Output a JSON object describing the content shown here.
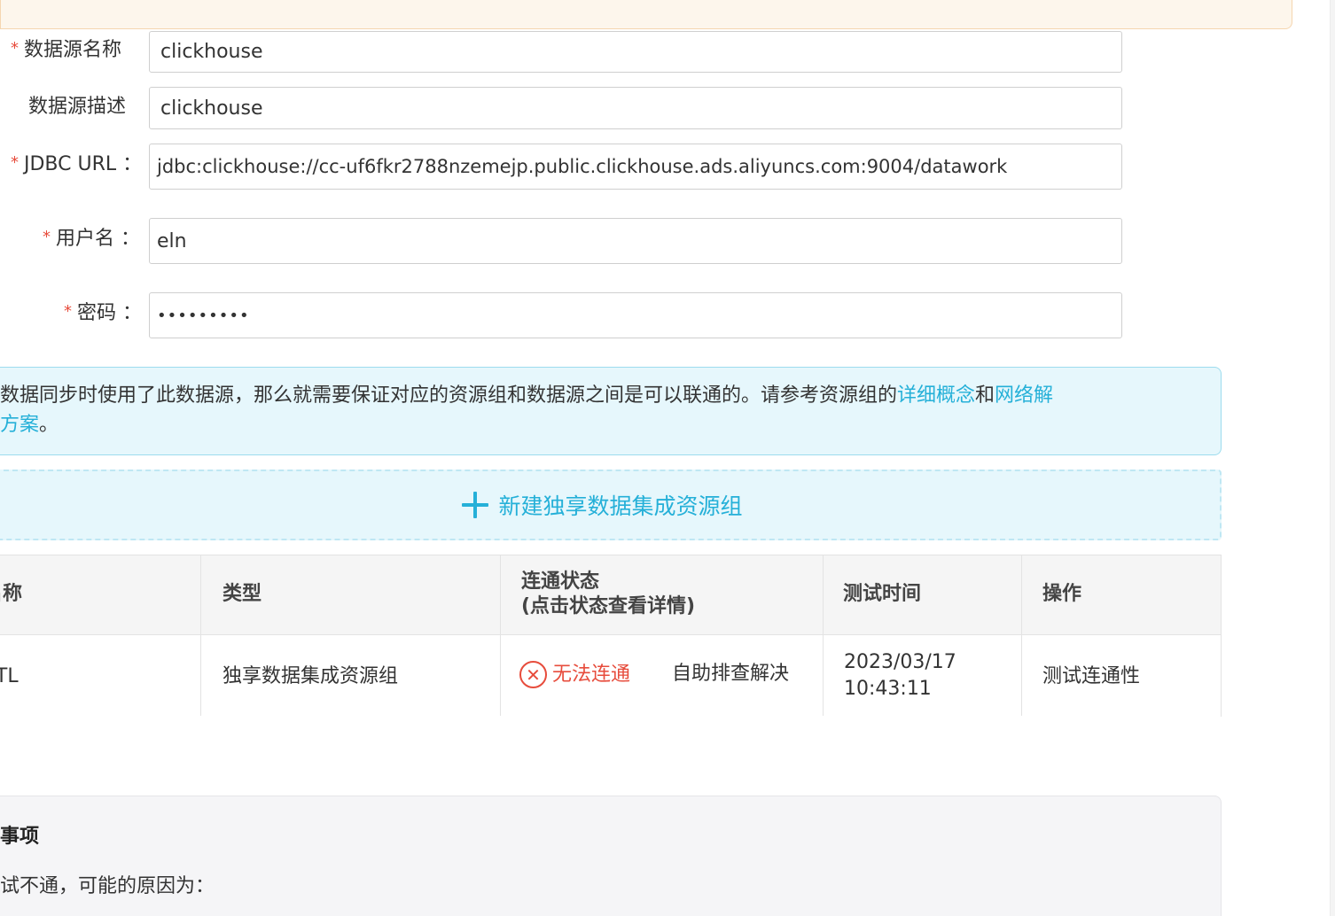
{
  "form": {
    "datasource_name": {
      "label": "数据源名称",
      "value": "clickhouse"
    },
    "datasource_desc": {
      "label": "数据源描述",
      "value": "clickhouse"
    },
    "jdbc_url": {
      "label": "JDBC URL ：",
      "value": "jdbc:clickhouse://cc-uf6fkr2788nzemejp.public.clickhouse.ads.aliyuncs.com:9004/datawork"
    },
    "username": {
      "label": "用户名 ：",
      "value": "eln"
    },
    "password": {
      "label": "密码 ：",
      "value": "•••••••••"
    },
    "required_mark": "*"
  },
  "info": {
    "text_before": "数据同步时使用了此数据源，那么就需要保证对应的资源组和数据源之间是可以联通的。请参考资源组的",
    "link_concept": "详细概念",
    "text_and": "和",
    "link_network_1": "网络解",
    "link_network_2": "决方案",
    "text_end": "。"
  },
  "add_group": {
    "label": "新建独享数据集成资源组"
  },
  "table": {
    "headers": {
      "name": "名称",
      "type": "类型",
      "status_1": "连通状态",
      "status_2": "(点击状态查看详情)",
      "test_time": "测试时间",
      "action": "操作"
    },
    "rows": [
      {
        "name": "ETL",
        "type": "独享数据集成资源组",
        "status": "无法连通",
        "self_help": "自助排查解决",
        "test_date": "2023/03/17",
        "test_clock": "10:43:11",
        "action": "测试连通性"
      }
    ]
  },
  "notes": {
    "title": "事项",
    "line1": "试不通，可能的原因为："
  }
}
